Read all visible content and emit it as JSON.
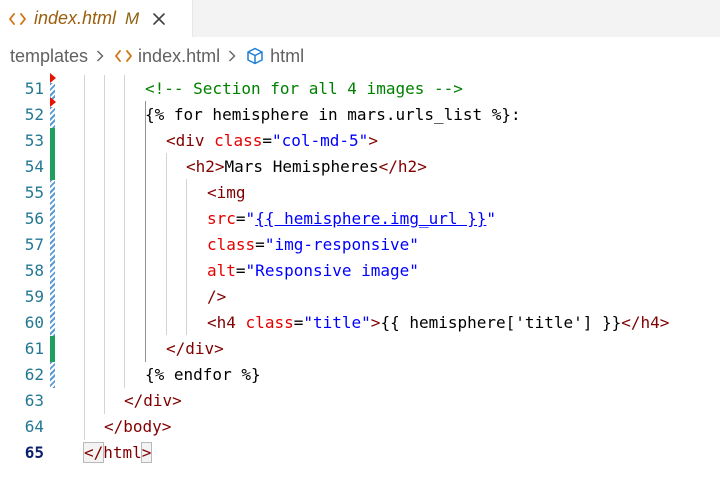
{
  "tab": {
    "icon": "html-angle-brackets-icon",
    "label": "index.html",
    "modified_badge": "M",
    "close_icon": "close-icon"
  },
  "breadcrumbs": {
    "folder": "templates",
    "file": "index.html",
    "symbol": "html"
  },
  "colors": {
    "comment": "#008000",
    "tag": "#800000",
    "attr": "#e50000",
    "string": "#0000ff",
    "line_number": "#237893",
    "active_line_number": "#0b216f",
    "git_modified": "#1e9f5c",
    "git_deleted": "#e51400"
  },
  "editor": {
    "lines": [
      {
        "num": "51",
        "tokens": [
          {
            "t": "<!-- Section for all 4 images -->",
            "c": "comment"
          }
        ]
      },
      {
        "num": "52",
        "tokens": [
          {
            "t": "{% for hemisphere in mars.urls_list %}:",
            "c": "plain"
          }
        ]
      },
      {
        "num": "53",
        "tokens": [
          {
            "t": "<div",
            "c": "tag"
          },
          {
            "t": " ",
            "c": "plain"
          },
          {
            "t": "class",
            "c": "attr"
          },
          {
            "t": "=",
            "c": "plain"
          },
          {
            "t": "\"col-md-5\"",
            "c": "str"
          },
          {
            "t": ">",
            "c": "tag"
          }
        ]
      },
      {
        "num": "54",
        "tokens": [
          {
            "t": "<h2>",
            "c": "tag"
          },
          {
            "t": "Mars Hemispheres",
            "c": "plain"
          },
          {
            "t": "</h2>",
            "c": "tag"
          }
        ]
      },
      {
        "num": "55",
        "tokens": [
          {
            "t": "<img",
            "c": "tag"
          }
        ]
      },
      {
        "num": "56",
        "tokens": [
          {
            "t": "src",
            "c": "attr"
          },
          {
            "t": "=",
            "c": "plain"
          },
          {
            "t": "\"",
            "c": "str"
          },
          {
            "t": "{{ hemisphere.img_url }}",
            "c": "link"
          },
          {
            "t": "\"",
            "c": "str"
          }
        ]
      },
      {
        "num": "57",
        "tokens": [
          {
            "t": "class",
            "c": "attr"
          },
          {
            "t": "=",
            "c": "plain"
          },
          {
            "t": "\"img-responsive\"",
            "c": "str"
          }
        ]
      },
      {
        "num": "58",
        "tokens": [
          {
            "t": "alt",
            "c": "attr"
          },
          {
            "t": "=",
            "c": "plain"
          },
          {
            "t": "\"Responsive image\"",
            "c": "str"
          }
        ]
      },
      {
        "num": "59",
        "tokens": [
          {
            "t": "/>",
            "c": "tag"
          }
        ]
      },
      {
        "num": "60",
        "tokens": [
          {
            "t": "<h4",
            "c": "tag"
          },
          {
            "t": " ",
            "c": "plain"
          },
          {
            "t": "class",
            "c": "attr"
          },
          {
            "t": "=",
            "c": "plain"
          },
          {
            "t": "\"title\"",
            "c": "str"
          },
          {
            "t": ">",
            "c": "tag"
          },
          {
            "t": "{{ hemisphere['title'] }}",
            "c": "plain"
          },
          {
            "t": "</h4>",
            "c": "tag"
          }
        ]
      },
      {
        "num": "61",
        "tokens": [
          {
            "t": "</div>",
            "c": "tag"
          }
        ]
      },
      {
        "num": "62",
        "tokens": [
          {
            "t": "{% endfor %}",
            "c": "plain"
          }
        ]
      },
      {
        "num": "63",
        "tokens": [
          {
            "t": "</div>",
            "c": "tag"
          }
        ]
      },
      {
        "num": "64",
        "tokens": [
          {
            "t": "</body>",
            "c": "tag"
          }
        ]
      },
      {
        "num": "65",
        "tokens": [
          {
            "t": "</",
            "c": "tag"
          },
          {
            "t": "html",
            "c": "tag"
          },
          {
            "t": ">",
            "c": "tag"
          }
        ]
      }
    ]
  }
}
